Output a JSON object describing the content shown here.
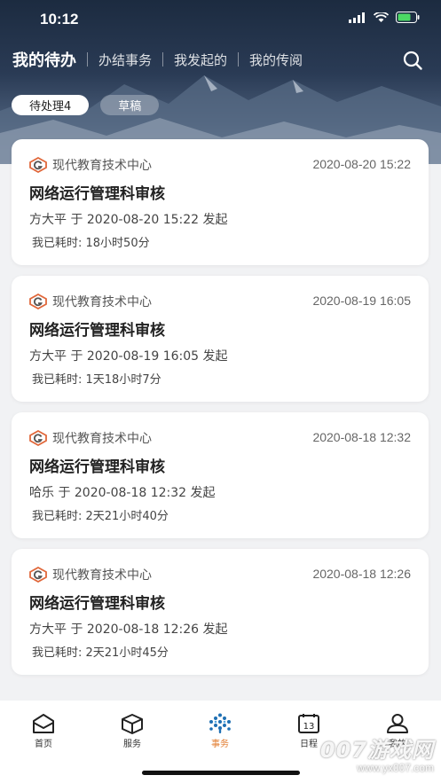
{
  "status_bar": {
    "time": "10:12"
  },
  "header": {
    "tabs": [
      {
        "label": "我的待办",
        "active": true
      },
      {
        "label": "办结事务",
        "active": false
      },
      {
        "label": "我发起的",
        "active": false
      },
      {
        "label": "我的传阅",
        "active": false
      }
    ],
    "search_icon": "search-icon"
  },
  "filters": [
    {
      "label": "待处理4",
      "active": true
    },
    {
      "label": "草稿",
      "active": false
    }
  ],
  "tasks": [
    {
      "org": "现代教育技术中心",
      "time": "2020-08-20 15:22",
      "title": "网络运行管理科审核",
      "initiator": "方大平 于 2020-08-20 15:22 发起",
      "elapsed": "我已耗时: 18小时50分"
    },
    {
      "org": "现代教育技术中心",
      "time": "2020-08-19 16:05",
      "title": "网络运行管理科审核",
      "initiator": "方大平 于 2020-08-19 16:05 发起",
      "elapsed": "我已耗时: 1天18小时7分"
    },
    {
      "org": "现代教育技术中心",
      "time": "2020-08-18 12:32",
      "title": "网络运行管理科审核",
      "initiator": "哈乐 于 2020-08-18 12:32 发起",
      "elapsed": "我已耗时: 2天21小时40分"
    },
    {
      "org": "现代教育技术中心",
      "time": "2020-08-18 12:26",
      "title": "网络运行管理科审核",
      "initiator": "方大平 于 2020-08-18 12:26 发起",
      "elapsed": "我已耗时: 2天21小时45分"
    }
  ],
  "tabbar": [
    {
      "label": "首页",
      "icon": "home-icon",
      "active": false
    },
    {
      "label": "服务",
      "icon": "cube-icon",
      "active": false
    },
    {
      "label": "事务",
      "icon": "tree-dots-icon",
      "active": true
    },
    {
      "label": "日程",
      "icon": "calendar-icon",
      "active": false,
      "calendar_day": "13"
    },
    {
      "label": "我的",
      "icon": "user-icon",
      "active": false
    }
  ],
  "watermark": {
    "main": "007游戏网",
    "sub": "www.yx007.com"
  },
  "colors": {
    "accent": "#e27b2e",
    "org_logo": "#e0673a",
    "header_bg": "#1c2b40"
  }
}
